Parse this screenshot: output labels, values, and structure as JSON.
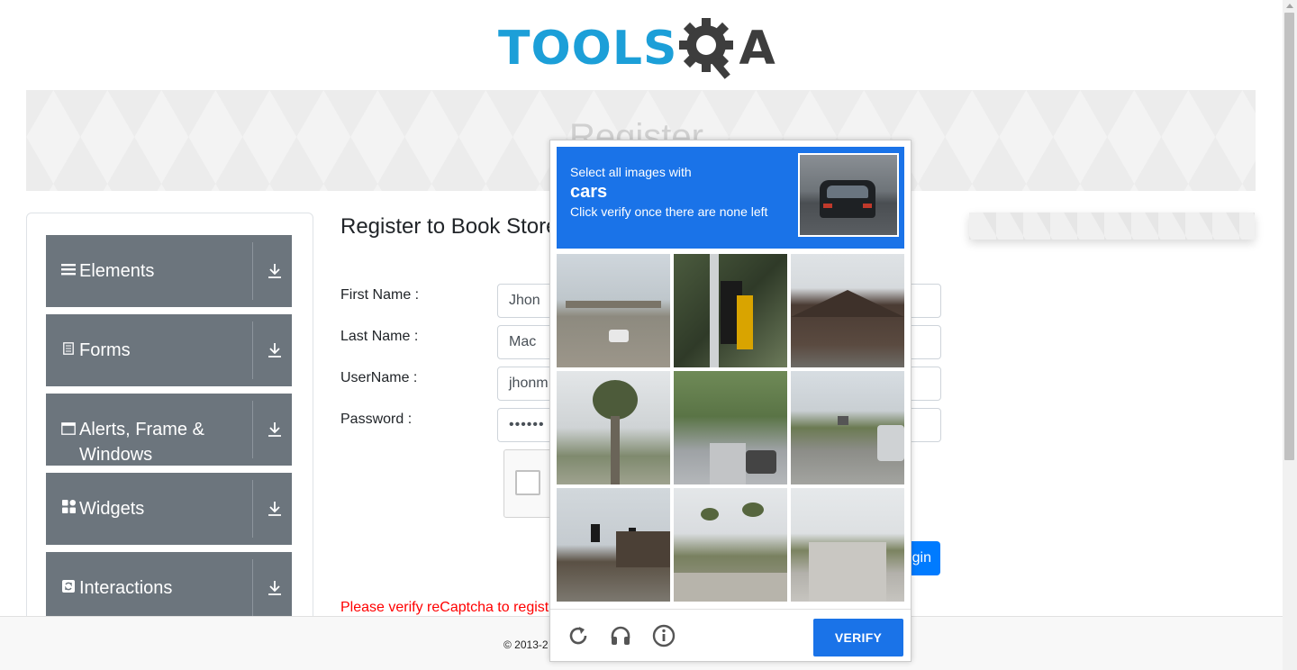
{
  "logo": {
    "text_blue": "TOOLS",
    "text_dark": "A"
  },
  "banner": {
    "title": "Register"
  },
  "sidebar": {
    "groups": [
      {
        "label": "Elements",
        "icon": "list-icon"
      },
      {
        "label": "Forms",
        "icon": "document-icon"
      },
      {
        "label": "Alerts, Frame & Windows",
        "icon": "window-icon"
      },
      {
        "label": "Widgets",
        "icon": "widgets-icon"
      },
      {
        "label": "Interactions",
        "icon": "interactions-icon"
      }
    ]
  },
  "form": {
    "title": "Register to Book Store",
    "first_name_label": "First Name :",
    "first_name_value": "Jhon",
    "last_name_label": "Last Name :",
    "last_name_value": "Mac",
    "username_label": "UserName :",
    "username_value": "jhonm",
    "password_label": "Password :",
    "password_value": "••••••",
    "login_label": "gin",
    "error": "Please verify reCaptcha to registe"
  },
  "footer": {
    "text": "© 2013-2"
  },
  "captcha": {
    "line1": "Select all images with",
    "target": "cars",
    "line3": "Click verify once there are none left",
    "verify_label": "VERIFY",
    "icons": [
      "reload-icon",
      "headphones-icon",
      "info-icon"
    ],
    "accent": "#1a73e8"
  }
}
